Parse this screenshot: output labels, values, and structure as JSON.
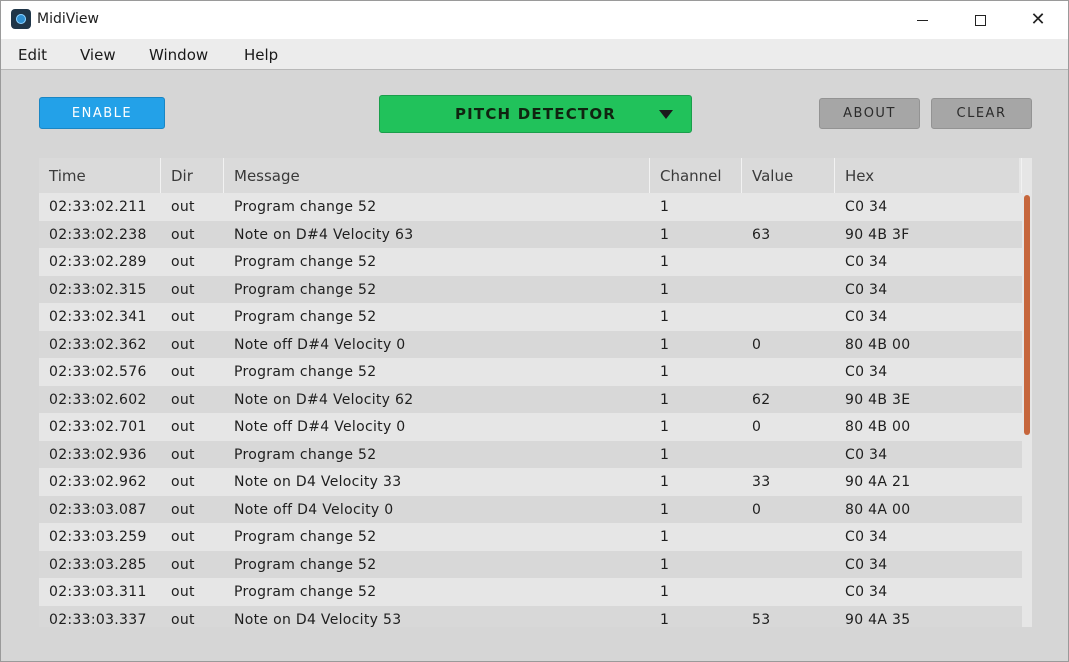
{
  "window": {
    "title": "MidiView"
  },
  "titlebar_controls": {
    "minimize_icon": "minimize-icon",
    "maximize_icon": "maximize-icon",
    "close_icon": "close-icon",
    "close_glyph": "✕"
  },
  "menu": [
    "Edit",
    "View",
    "Window",
    "Help"
  ],
  "toolbar": {
    "enable_label": "ENABLE",
    "selector_label": "PITCH DETECTOR",
    "about_label": "ABOUT",
    "clear_label": "CLEAR"
  },
  "colors": {
    "enable": "#23a1e8",
    "selector": "#21c25b",
    "scrollbar_thumb": "#c6663c"
  },
  "table": {
    "columns": [
      "Time",
      "Dir",
      "Message",
      "Channel",
      "Value",
      "Hex"
    ],
    "rows": [
      [
        "02:33:02.211",
        "out",
        "Program change 52",
        "1",
        "",
        "C0 34"
      ],
      [
        "02:33:02.238",
        "out",
        "Note on D#4 Velocity 63",
        "1",
        "63",
        "90 4B 3F"
      ],
      [
        "02:33:02.289",
        "out",
        "Program change 52",
        "1",
        "",
        "C0 34"
      ],
      [
        "02:33:02.315",
        "out",
        "Program change 52",
        "1",
        "",
        "C0 34"
      ],
      [
        "02:33:02.341",
        "out",
        "Program change 52",
        "1",
        "",
        "C0 34"
      ],
      [
        "02:33:02.362",
        "out",
        "Note off D#4 Velocity 0",
        "1",
        "0",
        "80 4B 00"
      ],
      [
        "02:33:02.576",
        "out",
        "Program change 52",
        "1",
        "",
        "C0 34"
      ],
      [
        "02:33:02.602",
        "out",
        "Note on D#4 Velocity 62",
        "1",
        "62",
        "90 4B 3E"
      ],
      [
        "02:33:02.701",
        "out",
        "Note off D#4 Velocity 0",
        "1",
        "0",
        "80 4B 00"
      ],
      [
        "02:33:02.936",
        "out",
        "Program change 52",
        "1",
        "",
        "C0 34"
      ],
      [
        "02:33:02.962",
        "out",
        "Note on D4 Velocity 33",
        "1",
        "33",
        "90 4A 21"
      ],
      [
        "02:33:03.087",
        "out",
        "Note off D4 Velocity 0",
        "1",
        "0",
        "80 4A 00"
      ],
      [
        "02:33:03.259",
        "out",
        "Program change 52",
        "1",
        "",
        "C0 34"
      ],
      [
        "02:33:03.285",
        "out",
        "Program change 52",
        "1",
        "",
        "C0 34"
      ],
      [
        "02:33:03.311",
        "out",
        "Program change 52",
        "1",
        "",
        "C0 34"
      ],
      [
        "02:33:03.337",
        "out",
        "Note on D4 Velocity 53",
        "1",
        "53",
        "90 4A 35"
      ]
    ]
  }
}
